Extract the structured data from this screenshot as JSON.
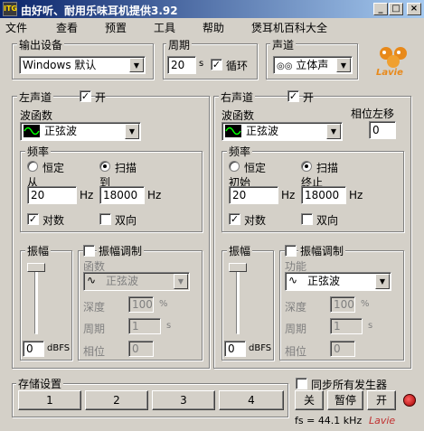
{
  "titlebar": {
    "icon_text": "ITG",
    "title": "由好听、耐用乐味耳机提供3.92"
  },
  "menu": [
    "文件",
    "查看",
    "预置",
    "工具",
    "帮助",
    "煲耳机百科大全"
  ],
  "output": {
    "label": "输出设备",
    "device": "Windows 默认"
  },
  "period": {
    "label": "周期",
    "value": "20",
    "unit": "s",
    "loop_label": "循环"
  },
  "channel": {
    "label": "声道",
    "value": "立体声"
  },
  "logo": {
    "brand": "Lavie",
    "accent_color": "#e8891a"
  },
  "left": {
    "label": "左声道",
    "enable_label": "开",
    "wave_label": "波函数",
    "wave": "正弦波",
    "freq_label": "频率",
    "const_label": "恒定",
    "sweep_label": "扫描",
    "from_label": "从",
    "to_label": "到",
    "from": "20",
    "to": "18000",
    "hz": "Hz",
    "log_label": "对数",
    "bidir_label": "双向",
    "amp_label": "振幅",
    "amp_value": "0",
    "dbfs": "dBFS",
    "mod_label": "振幅调制",
    "mod_func_label": "函数",
    "mod_wave": "正弦波",
    "depth_label": "深度",
    "depth": "100",
    "percent": "%",
    "mperiod_label": "周期",
    "mperiod": "1",
    "s": "s",
    "phase_label": "相位",
    "phase": "0"
  },
  "right": {
    "label": "右声道",
    "enable_label": "开",
    "wave_label": "波函数",
    "wave": "正弦波",
    "shift_label": "相位左移",
    "shift": "0",
    "freq_label": "频率",
    "const_label": "恒定",
    "sweep_label": "扫描",
    "from_label": "初始",
    "to_label": "终止",
    "from": "20",
    "to": "18000",
    "hz": "Hz",
    "log_label": "对数",
    "bidir_label": "双向",
    "amp_label": "振幅",
    "amp_value": "0",
    "dbfs": "dBFS",
    "mod_label": "振幅调制",
    "mod_func_label": "功能",
    "mod_wave": "正弦波",
    "depth_label": "深度",
    "depth": "100",
    "percent": "%",
    "mperiod_label": "周期",
    "mperiod": "1",
    "s": "s",
    "phase_label": "相位",
    "phase": "0"
  },
  "storage": {
    "label": "存储设置",
    "slots": [
      "1",
      "2",
      "3",
      "4"
    ]
  },
  "sync_label": "同步所有发生器",
  "controls": {
    "off": "关",
    "pause": "暂停",
    "on": "开"
  },
  "status": {
    "sample_rate": "fs = 44.1 kHz",
    "watermark": "Lavie"
  }
}
